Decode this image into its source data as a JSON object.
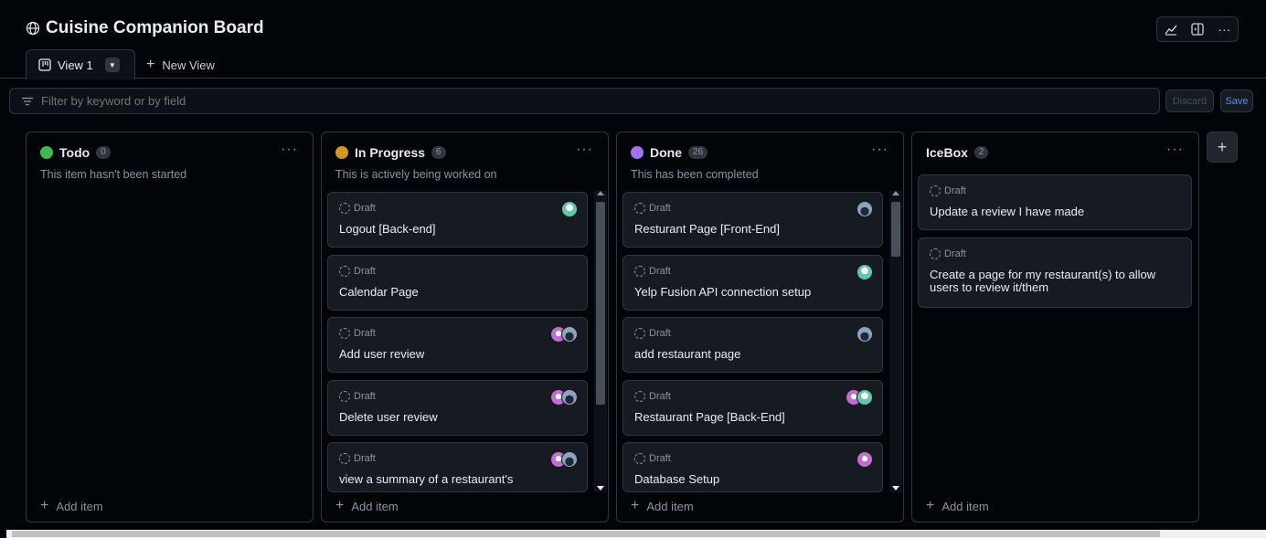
{
  "header": {
    "title": "Cuisine Companion Board",
    "actions": [
      "insights-icon",
      "layout-icon",
      "more-icon"
    ]
  },
  "tabs": {
    "active_label": "View 1",
    "new_label": "New View"
  },
  "filter": {
    "placeholder": "Filter by keyword or by field",
    "discard_label": "Discard",
    "save_label": "Save"
  },
  "columns": [
    {
      "name": "Todo",
      "count": "0",
      "color": "#3fb950",
      "description": "This item hasn't been started",
      "add_label": "Add item",
      "cards": []
    },
    {
      "name": "In Progress",
      "count": "6",
      "color": "#d29922",
      "description": "This is actively being worked on",
      "add_label": "Add item",
      "cards": [
        {
          "status": "Draft",
          "title": "Logout [Back-end]",
          "avatars": [
            "teal"
          ]
        },
        {
          "status": "Draft",
          "title": "Calendar Page",
          "avatars": []
        },
        {
          "status": "Draft",
          "title": "Add user review",
          "avatars": [
            "pink",
            "dark"
          ]
        },
        {
          "status": "Draft",
          "title": "Delete user review",
          "avatars": [
            "pink",
            "dark"
          ]
        },
        {
          "status": "Draft",
          "title": "view a summary of a restaurant's",
          "avatars": [
            "pink",
            "dark"
          ]
        }
      ]
    },
    {
      "name": "Done",
      "count": "26",
      "color": "#a371f7",
      "description": "This has been completed",
      "add_label": "Add item",
      "cards": [
        {
          "status": "Draft",
          "title": "Resturant Page [Front-End]",
          "avatars": [
            "dark"
          ]
        },
        {
          "status": "Draft",
          "title": "Yelp Fusion API connection setup",
          "avatars": [
            "teal"
          ]
        },
        {
          "status": "Draft",
          "title": "add restaurant page",
          "avatars": [
            "dark"
          ]
        },
        {
          "status": "Draft",
          "title": "Restaurant Page [Back-End]",
          "avatars": [
            "pink",
            "teal"
          ]
        },
        {
          "status": "Draft",
          "title": "Database Setup",
          "avatars": [
            "pink"
          ]
        }
      ]
    },
    {
      "name": "IceBox",
      "count": "2",
      "color": "",
      "description": "",
      "add_label": "Add item",
      "cards": [
        {
          "status": "Draft",
          "title": "Update a review I have made",
          "avatars": []
        },
        {
          "status": "Draft",
          "title": "Create a page for my restaurant(s) to allow users to review it/them",
          "avatars": []
        }
      ]
    }
  ]
}
